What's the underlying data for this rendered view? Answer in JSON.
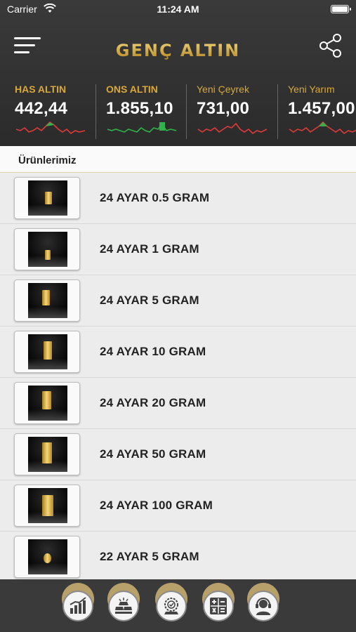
{
  "status_bar": {
    "carrier": "Carrier",
    "time": "11:24 AM"
  },
  "header": {
    "brand": "GENÇ ALTIN"
  },
  "tickers": [
    {
      "name": "HAS ALTIN",
      "price": "442,44",
      "trend": "up"
    },
    {
      "name": "ONS ALTIN",
      "price": "1.855,10",
      "trend": "up"
    },
    {
      "name": "Yeni Çeyrek",
      "price": "731,00",
      "trend": "down"
    },
    {
      "name": "Yeni Yarım",
      "price": "1.457,00",
      "trend": "up"
    }
  ],
  "section": {
    "title": "Ürünlerimiz"
  },
  "products": [
    {
      "name": "24 AYAR 0.5 GRAM"
    },
    {
      "name": "24 AYAR 1 GRAM"
    },
    {
      "name": "24 AYAR 5 GRAM"
    },
    {
      "name": "24 AYAR 10 GRAM"
    },
    {
      "name": "24 AYAR 20 GRAM"
    },
    {
      "name": "24 AYAR 50 GRAM"
    },
    {
      "name": "24 AYAR 100 GRAM"
    },
    {
      "name": "22 AYAR 5 GRAM"
    }
  ],
  "tabbar": {
    "tabs": [
      {
        "icon": "chart-icon"
      },
      {
        "icon": "gold-bars-icon"
      },
      {
        "icon": "quality-badge-icon"
      },
      {
        "icon": "calculator-icon"
      },
      {
        "icon": "support-agent-icon"
      }
    ]
  },
  "colors": {
    "gold": "#caa23e",
    "header_bg": "#2f2f2f",
    "up": "#2fb34a",
    "down": "#e03a3a"
  }
}
